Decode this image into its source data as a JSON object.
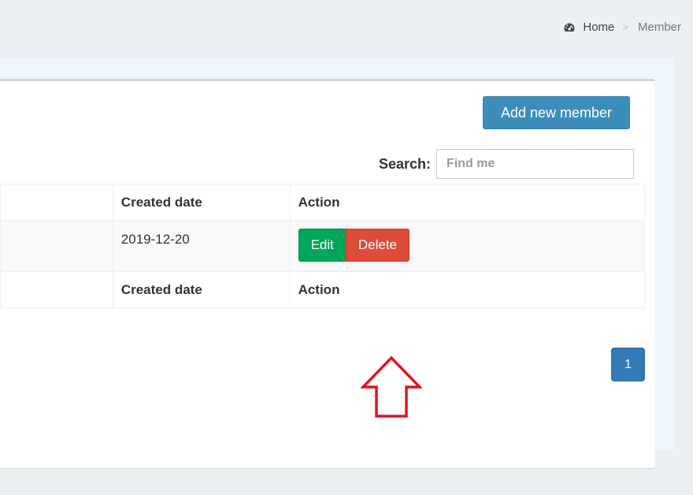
{
  "breadcrumb": {
    "home": "Home",
    "separator": ">",
    "current": "Member",
    "icon": "dashboard-icon"
  },
  "box": {
    "add_button": "Add new member"
  },
  "search": {
    "label": "Search:",
    "placeholder": "Find me"
  },
  "table": {
    "header": [
      "",
      "Created date",
      "Action"
    ],
    "rows": [
      {
        "first": "",
        "created": "2019-12-20"
      }
    ],
    "footer": [
      "",
      "Created date",
      "Action"
    ],
    "row_actions": {
      "edit": "Edit",
      "delete": "Delete"
    }
  },
  "pagination": {
    "current_page": "1"
  },
  "annotation": {
    "type": "arrow-up",
    "color": "#e0161f",
    "icon": "up-arrow-icon"
  },
  "colors": {
    "primary": "#3c8dbc",
    "success": "#00a65a",
    "danger": "#dd4b39",
    "page_bg": "#ecf0f5"
  }
}
